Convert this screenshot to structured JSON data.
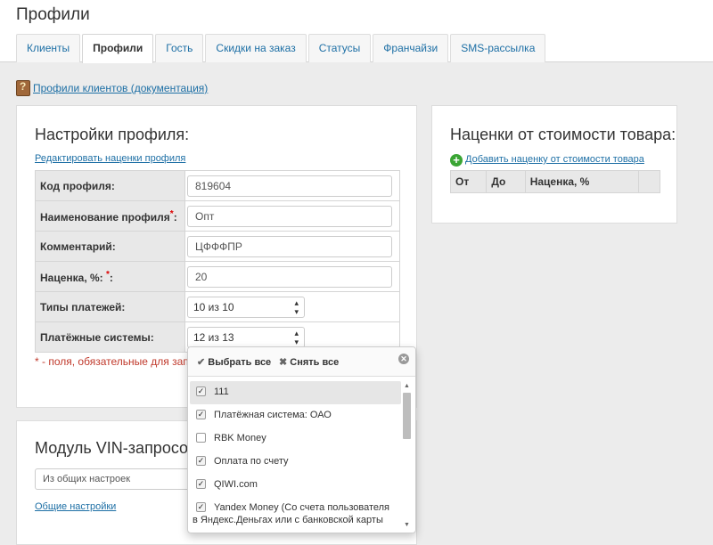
{
  "page_title": "Профили",
  "tabs": [
    {
      "label": "Клиенты",
      "active": false
    },
    {
      "label": "Профили",
      "active": true
    },
    {
      "label": "Гость",
      "active": false
    },
    {
      "label": "Скидки на заказ",
      "active": false
    },
    {
      "label": "Статусы",
      "active": false
    },
    {
      "label": "Франчайзи",
      "active": false
    },
    {
      "label": "SMS-рассылка",
      "active": false
    }
  ],
  "doc_link": "Профили клиентов (документация)",
  "profile_settings": {
    "title": "Настройки профиля:",
    "edit_markups_link": "Редактировать наценки профиля",
    "fields": {
      "code": {
        "label": "Код профиля:",
        "value": "819604"
      },
      "name": {
        "label": "Наименование профиля",
        "suffix": ":",
        "required_mark": "*",
        "value": "Опт"
      },
      "comment": {
        "label": "Комментарий:",
        "value": "ЦФФФПР"
      },
      "markup": {
        "label": "Наценка, %:",
        "suffix": ":",
        "required_mark": "*",
        "value": "20"
      },
      "payment_types": {
        "label": "Типы платежей:",
        "value": "10 из 10"
      },
      "payment_systems": {
        "label": "Платёжные системы:",
        "value": "12 из 13"
      }
    },
    "required_note": "* - поля, обязательные для заполнения"
  },
  "markups_panel": {
    "title": "Наценки от стоимости товара:",
    "add_link": "Добавить наценку от стоимости товара",
    "columns": [
      "От",
      "До",
      "Наценка, %",
      ""
    ]
  },
  "vin_module": {
    "title": "Модуль VIN-запросов:",
    "select_value": "Из общих настроек",
    "general_settings_link": "Общие настройки"
  },
  "dropdown": {
    "select_all": "Выбрать все",
    "deselect_all": "Снять все",
    "items": [
      {
        "label": "111",
        "checked": true
      },
      {
        "label": "Платёжная система: ОАО",
        "checked": true
      },
      {
        "label": "RBK Money",
        "checked": false
      },
      {
        "label": "Оплата по счету",
        "checked": true
      },
      {
        "label": "QIWI.com",
        "checked": true
      },
      {
        "label": "Yandex Money (Со счета пользователя",
        "checked": true
      },
      {
        "label": "в Яндекс.Деньгах или с банковской карты",
        "checked": null
      }
    ]
  },
  "colors": {
    "link": "#1d6fa5",
    "required": "#d00000",
    "checkbox_accent": "#3aa534"
  }
}
